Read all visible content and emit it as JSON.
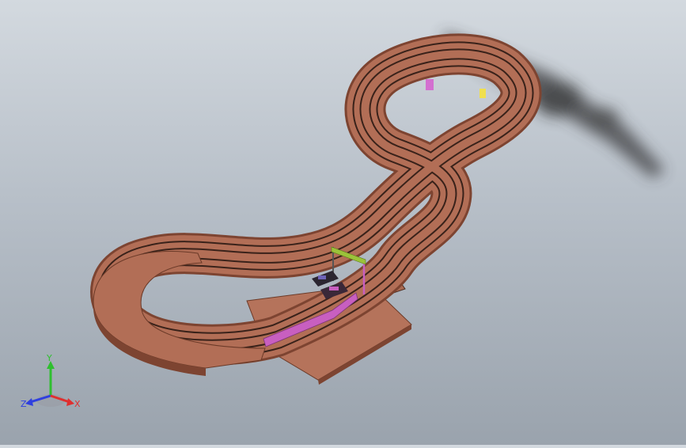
{
  "viewport": {
    "background_top": "#d3d9df",
    "background_bottom": "#9aa3ad",
    "track_color": "#b26e56",
    "track_dark": "#7d4431",
    "groove_color": "#2b1a14",
    "base_color": "#b5735b",
    "guard_rail_color": "#c85fc0",
    "gate_color": "#9bc23a",
    "support_colors": {
      "pink": "#d36fd0",
      "yellow": "#f0df4e",
      "tan": "#f2c38a",
      "blue": "#2747d8"
    }
  },
  "triad": {
    "labels": {
      "y": "Y",
      "z": "Z",
      "x": "X"
    },
    "colors": {
      "y": "#2fbf2f",
      "z": "#2f3fdf",
      "x": "#df2f2f"
    },
    "icon": "coordinate-triad-icon"
  }
}
